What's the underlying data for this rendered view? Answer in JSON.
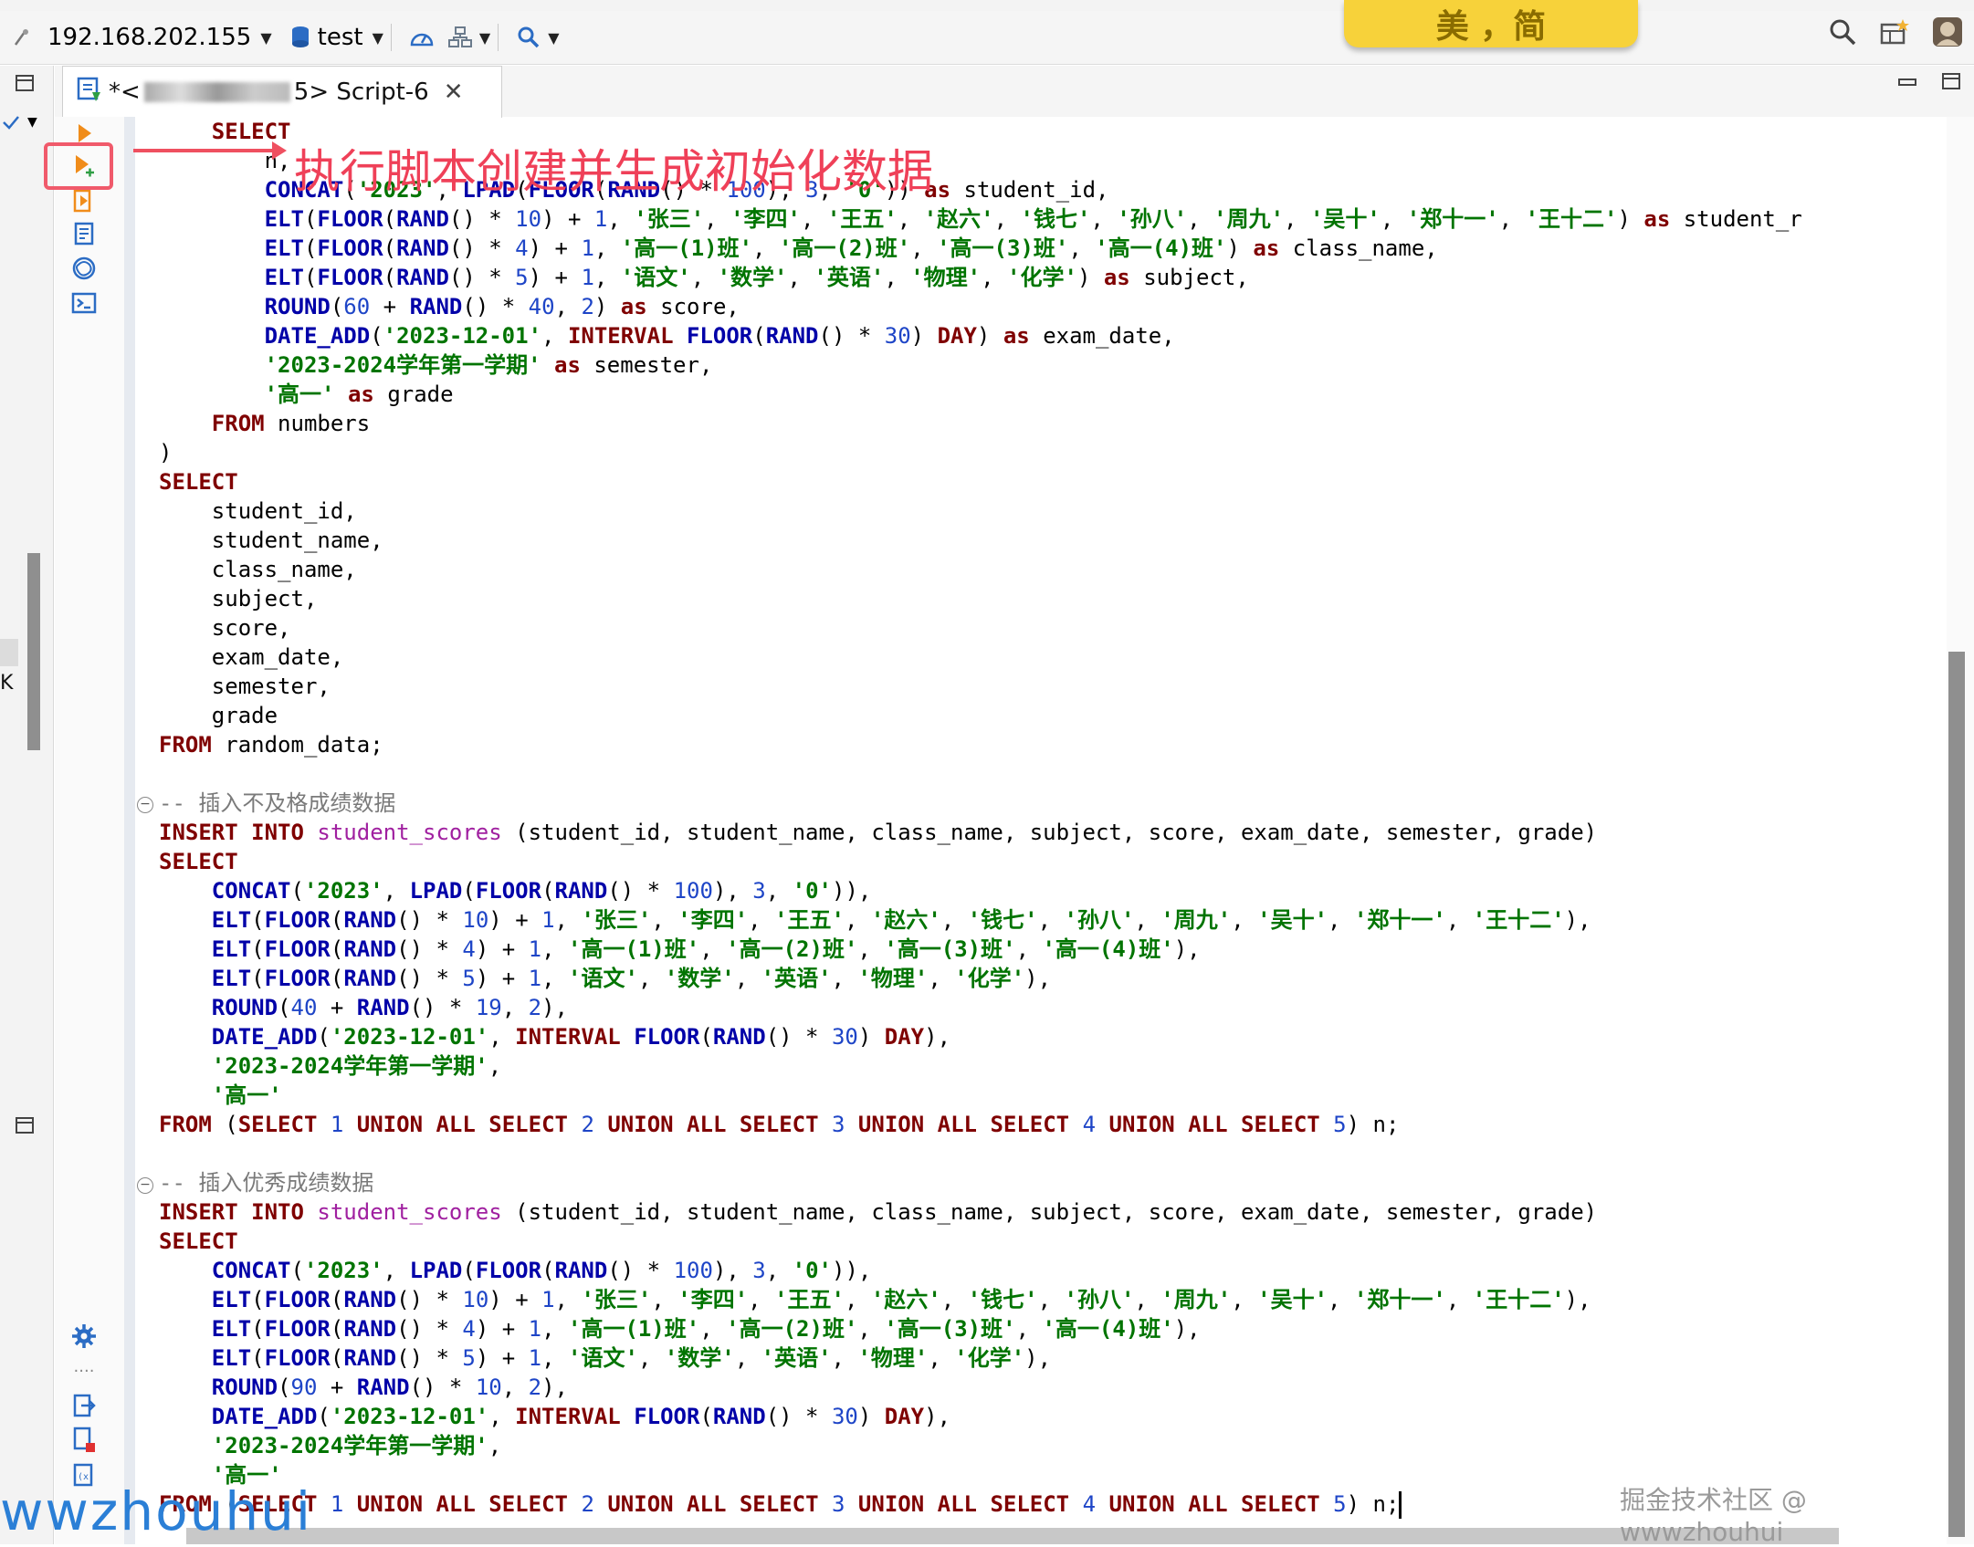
{
  "toolbar": {
    "connection": "192.168.202.155",
    "database": "test",
    "sticker_text": "美 ，简"
  },
  "tab": {
    "prefix": "*<",
    "suffix": "5> Script-6"
  },
  "annotation": {
    "text": "执行脚本创建并生成初始化数据"
  },
  "watermark": {
    "left": "wwzhouhui",
    "right": "掘金技术社区 @ wwwzhouhui"
  },
  "code_lines": [
    "    SELECT",
    "        n,",
    "        CONCAT('2023', LPAD(FLOOR(RAND() * 100), 3, '0')) as student_id,",
    "        ELT(FLOOR(RAND() * 10) + 1, '张三', '李四', '王五', '赵六', '钱七', '孙八', '周九', '吴十', '郑十一', '王十二') as student_r",
    "        ELT(FLOOR(RAND() * 4) + 1, '高一(1)班', '高一(2)班', '高一(3)班', '高一(4)班') as class_name,",
    "        ELT(FLOOR(RAND() * 5) + 1, '语文', '数学', '英语', '物理', '化学') as subject,",
    "        ROUND(60 + RAND() * 40, 2) as score,",
    "        DATE_ADD('2023-12-01', INTERVAL FLOOR(RAND() * 30) DAY) as exam_date,",
    "        '2023-2024学年第一学期' as semester,",
    "        '高一' as grade",
    "    FROM numbers",
    ")",
    "SELECT",
    "    student_id,",
    "    student_name,",
    "    class_name,",
    "    subject,",
    "    score,",
    "    exam_date,",
    "    semester,",
    "    grade",
    "FROM random_data;",
    "",
    "-- 插入不及格成绩数据",
    "INSERT INTO student_scores (student_id, student_name, class_name, subject, score, exam_date, semester, grade)",
    "SELECT",
    "    CONCAT('2023', LPAD(FLOOR(RAND() * 100), 3, '0')),",
    "    ELT(FLOOR(RAND() * 10) + 1, '张三', '李四', '王五', '赵六', '钱七', '孙八', '周九', '吴十', '郑十一', '王十二'),",
    "    ELT(FLOOR(RAND() * 4) + 1, '高一(1)班', '高一(2)班', '高一(3)班', '高一(4)班'),",
    "    ELT(FLOOR(RAND() * 5) + 1, '语文', '数学', '英语', '物理', '化学'),",
    "    ROUND(40 + RAND() * 19, 2),",
    "    DATE_ADD('2023-12-01', INTERVAL FLOOR(RAND() * 30) DAY),",
    "    '2023-2024学年第一学期',",
    "    '高一'",
    "FROM (SELECT 1 UNION ALL SELECT 2 UNION ALL SELECT 3 UNION ALL SELECT 4 UNION ALL SELECT 5) n;",
    "",
    "-- 插入优秀成绩数据",
    "INSERT INTO student_scores (student_id, student_name, class_name, subject, score, exam_date, semester, grade)",
    "SELECT",
    "    CONCAT('2023', LPAD(FLOOR(RAND() * 100), 3, '0')),",
    "    ELT(FLOOR(RAND() * 10) + 1, '张三', '李四', '王五', '赵六', '钱七', '孙八', '周九', '吴十', '郑十一', '王十二'),",
    "    ELT(FLOOR(RAND() * 4) + 1, '高一(1)班', '高一(2)班', '高一(3)班', '高一(4)班'),",
    "    ELT(FLOOR(RAND() * 5) + 1, '语文', '数学', '英语', '物理', '化学'),",
    "    ROUND(90 + RAND() * 10, 2),",
    "    DATE_ADD('2023-12-01', INTERVAL FLOOR(RAND() * 30) DAY),",
    "    '2023-2024学年第一学期',",
    "    '高一'",
    "FROM (SELECT 1 UNION ALL SELECT 2 UNION ALL SELECT 3 UNION ALL SELECT 4 UNION ALL SELECT 5) n;"
  ],
  "icons": [
    "connection-icon",
    "database-icon",
    "dashboard-icon",
    "schema-icon",
    "search-icon",
    "execute-statement-icon",
    "execute-script-icon",
    "explain-icon",
    "format-icon",
    "ai-assistant-icon",
    "terminal-icon",
    "settings-icon",
    "export-icon",
    "error-file-icon",
    "variables-icon",
    "global-search-icon",
    "perspective-icon",
    "user-avatar-icon"
  ],
  "colors": {
    "keyword": "#7f0000",
    "function": "#0000a8",
    "string": "#007400",
    "number": "#1e45c7",
    "table": "#a020a0",
    "comment": "#7a7a7a",
    "annotation": "#ef4058"
  }
}
